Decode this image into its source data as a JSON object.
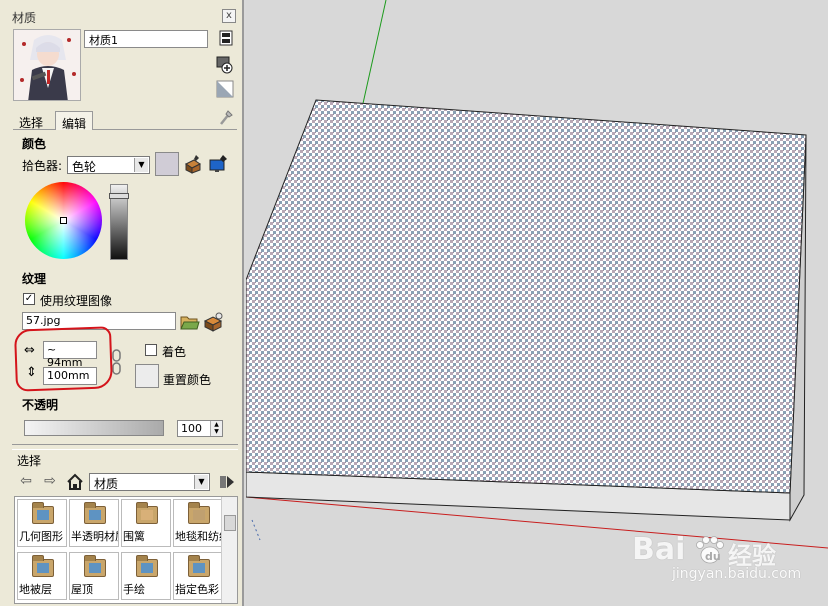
{
  "panel": {
    "title": "材质",
    "close_symbol": "x",
    "material_name": "材质1",
    "tabs": [
      {
        "label": "选择",
        "selected": false
      },
      {
        "label": "编辑",
        "selected": true
      }
    ],
    "color_section": "颜色",
    "picker_label": "拾色器:",
    "picker_value": "色轮",
    "texture_section": "纹理",
    "use_texture_label": "使用纹理图像",
    "use_texture_checked": true,
    "texture_file": "57.jpg",
    "width_value": "~ 94mm",
    "height_value": "100mm",
    "colorize_label": "着色",
    "colorize_checked": false,
    "reset_color_label": "重置颜色",
    "opacity_section": "不透明",
    "opacity_value": "100"
  },
  "library": {
    "header": "选择",
    "collection": "材质",
    "items": [
      {
        "label": "几何图形",
        "icon": "folder-icon"
      },
      {
        "label": "半透明材质",
        "icon": "folder-icon"
      },
      {
        "label": "围篱",
        "icon": "folder-icon"
      },
      {
        "label": "地毯和纺织品",
        "icon": "folder-icon"
      },
      {
        "label": "地被层",
        "icon": "folder-icon"
      },
      {
        "label": "屋顶",
        "icon": "folder-icon"
      },
      {
        "label": "手绘",
        "icon": "folder-icon"
      },
      {
        "label": "指定色彩",
        "icon": "folder-icon"
      }
    ]
  },
  "viewport": {
    "axis_colors": {
      "green": "#1a9a1a",
      "red": "#c81e1e"
    },
    "texture_colors": [
      "#ffffff",
      "#b8a8b6",
      "#8aa0b4"
    ],
    "watermark": {
      "brand": "Bai",
      "brand_tail": "经验",
      "url": "jingyan.baidu.com"
    }
  },
  "accent": {
    "annotation_red": "#d4141b",
    "panel_bg": "#ece9d8"
  }
}
